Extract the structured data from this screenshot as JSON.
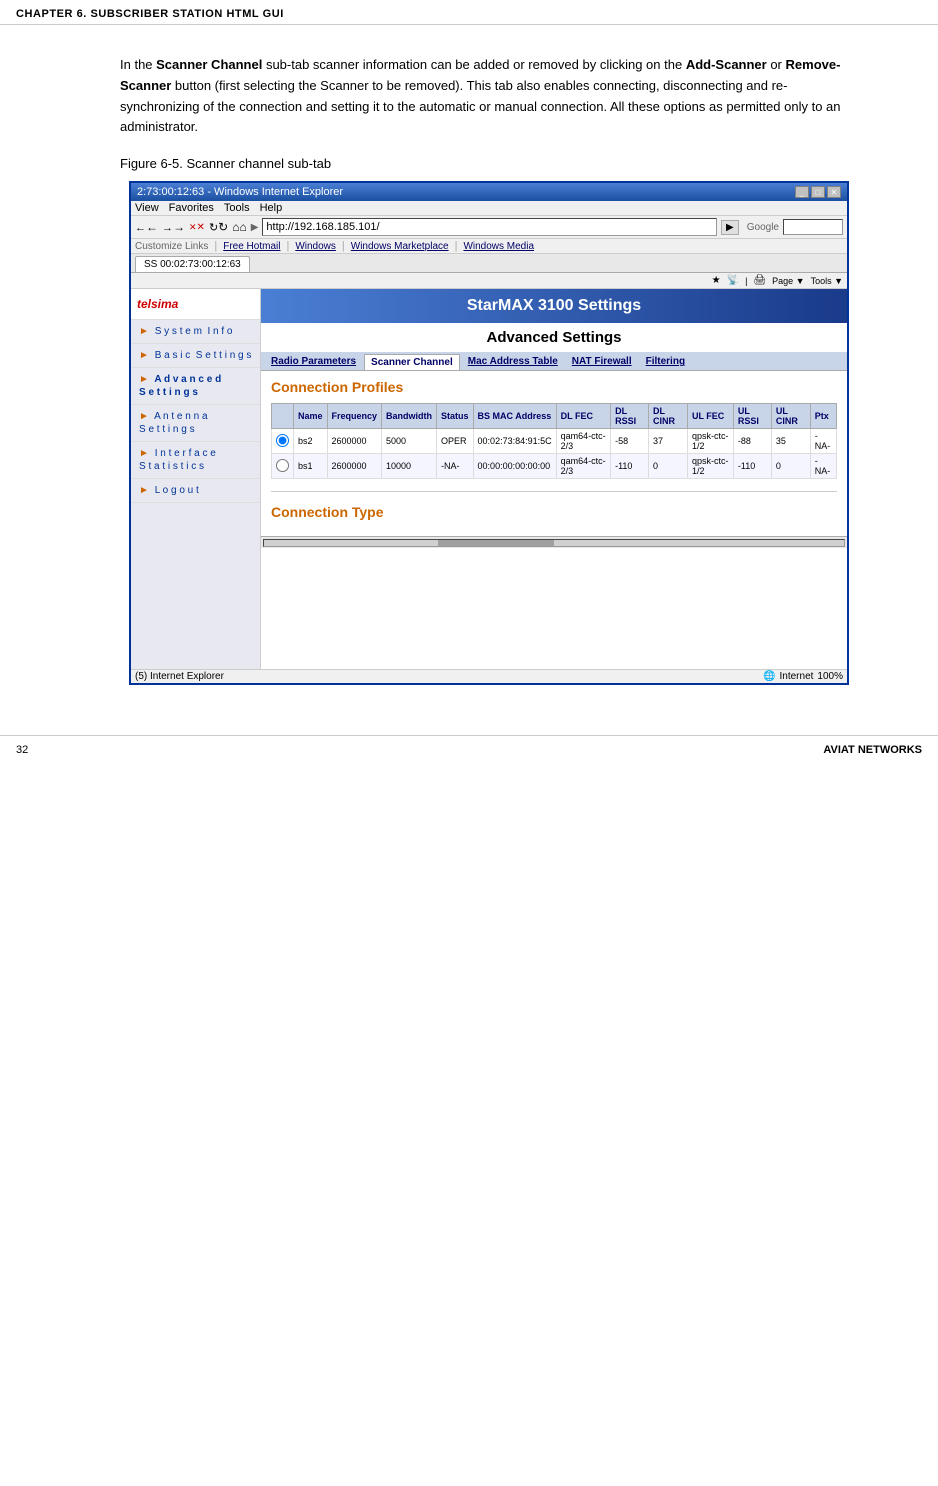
{
  "header": {
    "chapter": "CHAPTER 6. SUBSCRIBER STATION HTML GUI",
    "page_number": "32",
    "company": "AVIAT NETWORKS"
  },
  "intro": {
    "text_parts": [
      "In the ",
      "Scanner Channel",
      " sub-tab scanner information can be added or removed by clicking on the ",
      "Add-Scanner",
      " or ",
      "Remove-Scanner",
      " button (first selecting the Scanner to be removed). This tab also enables connecting, disconnecting and re-synchronizing of the connection and setting it to the automatic or manual connection. All these options as permitted only to an administrator."
    ]
  },
  "figure": {
    "label": "Figure 6-5.",
    "caption": "Scanner channel sub-tab"
  },
  "browser": {
    "titlebar": "2:73:00:12:63 - Windows Internet Explorer",
    "address": "http://192.168.185.101/",
    "menus": [
      "View",
      "Favorites",
      "Tools",
      "Help"
    ],
    "bookmarks": [
      "Customize Links",
      "Free Hotmail",
      "Windows",
      "Windows Marketplace",
      "Windows Media"
    ],
    "tab_label": "SS 00:02:73:00:12:63",
    "status_bar": "(5) Internet Explorer",
    "status_right": "Internet",
    "zoom": "100%"
  },
  "webpage": {
    "logo": "telsima",
    "product_title": "StarMAX 3100 Settings",
    "section_title": "Advanced Settings",
    "nav_items": [
      {
        "label": "System Info"
      },
      {
        "label": "Basic Settings"
      },
      {
        "label": "Advanced Settings",
        "active": true
      },
      {
        "label": "Antenna Settings"
      },
      {
        "label": "Interface Statistics"
      },
      {
        "label": "Logout"
      }
    ],
    "tabs": [
      {
        "label": "Radio Parameters",
        "active": false
      },
      {
        "label": "Scanner Channel",
        "active": true
      },
      {
        "label": "Mac Address Table",
        "active": false
      },
      {
        "label": "NAT Firewall",
        "active": false
      },
      {
        "label": "Filtering",
        "active": false
      }
    ],
    "connection_profiles_title": "Connection Profiles",
    "table": {
      "headers": [
        "",
        "Name",
        "Frequency",
        "Bandwidth",
        "Status",
        "BS MAC Address",
        "DL FEC",
        "DL RSSI",
        "DL CINR",
        "UL FEC",
        "UL RSSI",
        "UL CINR",
        "Ptx"
      ],
      "rows": [
        {
          "radio": true,
          "name": "bs2",
          "frequency": "2600000",
          "bandwidth": "5000",
          "status": "OPER",
          "mac": "00:02:73:84:91:5C",
          "dl_fec": "qam64-ctc-2/3",
          "dl_rssi": "-58",
          "dl_cinr": "37",
          "ul_fec": "qpsk-ctc-1/2",
          "ul_rssi": "-88",
          "ul_cinr": "35",
          "ptx": "-NA-"
        },
        {
          "radio": false,
          "name": "bs1",
          "frequency": "2600000",
          "bandwidth": "10000",
          "status": "-NA-",
          "mac": "00:00:00:00:00:00",
          "dl_fec": "qam64-ctc-2/3",
          "dl_rssi": "-110",
          "dl_cinr": "0",
          "ul_fec": "qpsk-ctc-1/2",
          "ul_rssi": "-110",
          "ul_cinr": "0",
          "ptx": "-NA-"
        }
      ]
    },
    "connection_type_title": "Connection Type"
  },
  "colors": {
    "nav_bg": "#e8e8f0",
    "header_bg": "#1a3a8a",
    "tab_bg": "#c8d4e8",
    "section_color": "#cc6600",
    "link_color": "#000066",
    "browser_border": "#003399"
  }
}
